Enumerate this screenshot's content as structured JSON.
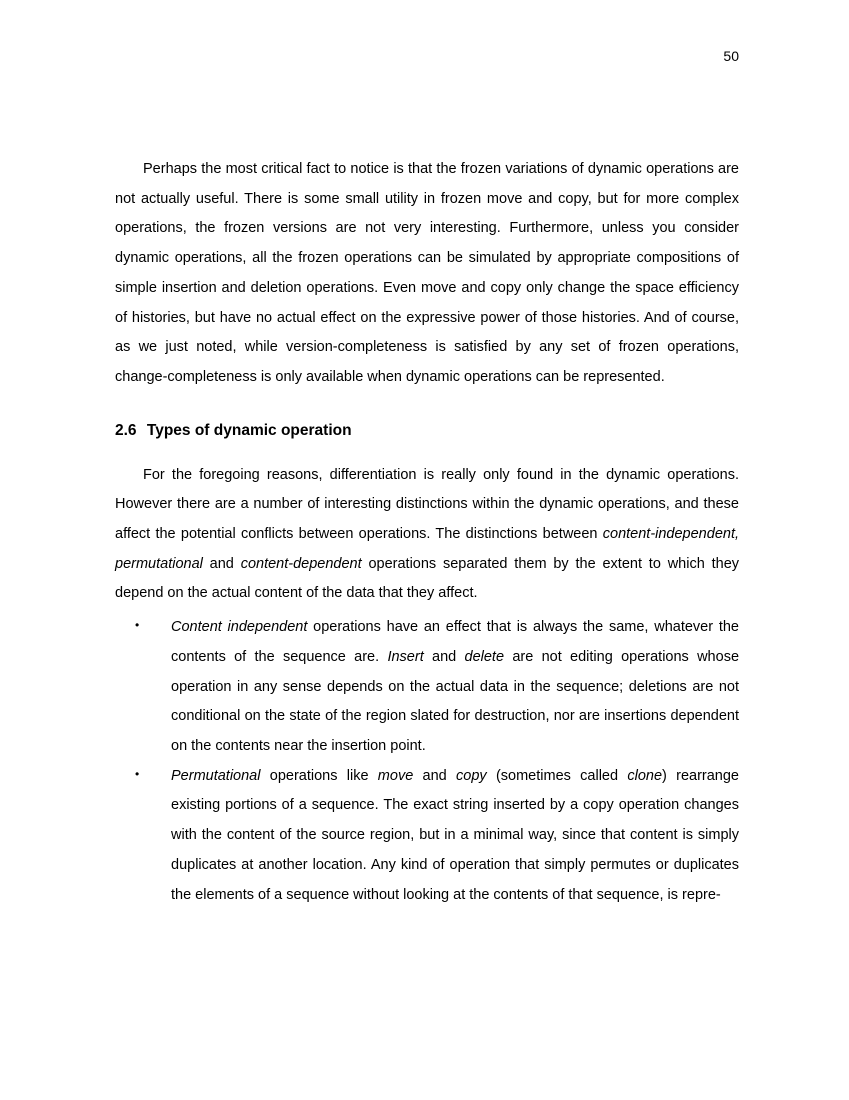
{
  "pageNumber": "50",
  "para1_a": "Perhaps the most critical fact to notice is that the frozen variations of dynamic operations are not actually useful. There is some small utility in frozen move and copy, but for more complex operations, the frozen versions are not very interesting. Furthermore, unless you consider dynamic operations, all the frozen operations can be simulated by appropriate compositions of simple insertion and deletion operations. Even move and copy only change the space efficiency of histories, but have no actual effect on the expressive power of those histories. And of course, as we just noted, while version-completeness is satisfied by any set of frozen operations, change-completeness is only available when dynamic operations can be represented.",
  "sectionNumber": "2.6",
  "sectionTitle": "Types of dynamic operation",
  "para2_a": "For the foregoing reasons, differentiation is really only found in the dynamic operations. However there are a number of interesting distinctions within the dynamic operations, and these affect the potential conflicts between operations. The distinctions between ",
  "para2_i1": "content-independent, permutational",
  "para2_b": " and ",
  "para2_i2": "content-dependent",
  "para2_c": " operations separated them by the extent to which they depend on the actual content of the data that they affect.",
  "li1_i1": "Content independent",
  "li1_a": " operations have an effect that is always the same, whatever the contents of the sequence are. ",
  "li1_i2": "Insert",
  "li1_b": " and ",
  "li1_i3": "delete",
  "li1_c": " are not editing operations whose operation in any sense depends on the actual data in the sequence; deletions are not conditional on the state of the region slated for destruction, nor are insertions dependent on the contents near the insertion point.",
  "li2_i1": "Permutational",
  "li2_a": " operations like ",
  "li2_i2": "move",
  "li2_b": " and ",
  "li2_i3": "copy",
  "li2_c": " (sometimes called ",
  "li2_i4": "clone",
  "li2_d": ") rearrange existing portions of a sequence. The exact string inserted by a copy operation changes with the content of the source region, but in a minimal way, since that content is simply duplicates at another location. Any kind of operation that simply permutes or duplicates the elements of a sequence without looking at the contents of that sequence, is repre-"
}
